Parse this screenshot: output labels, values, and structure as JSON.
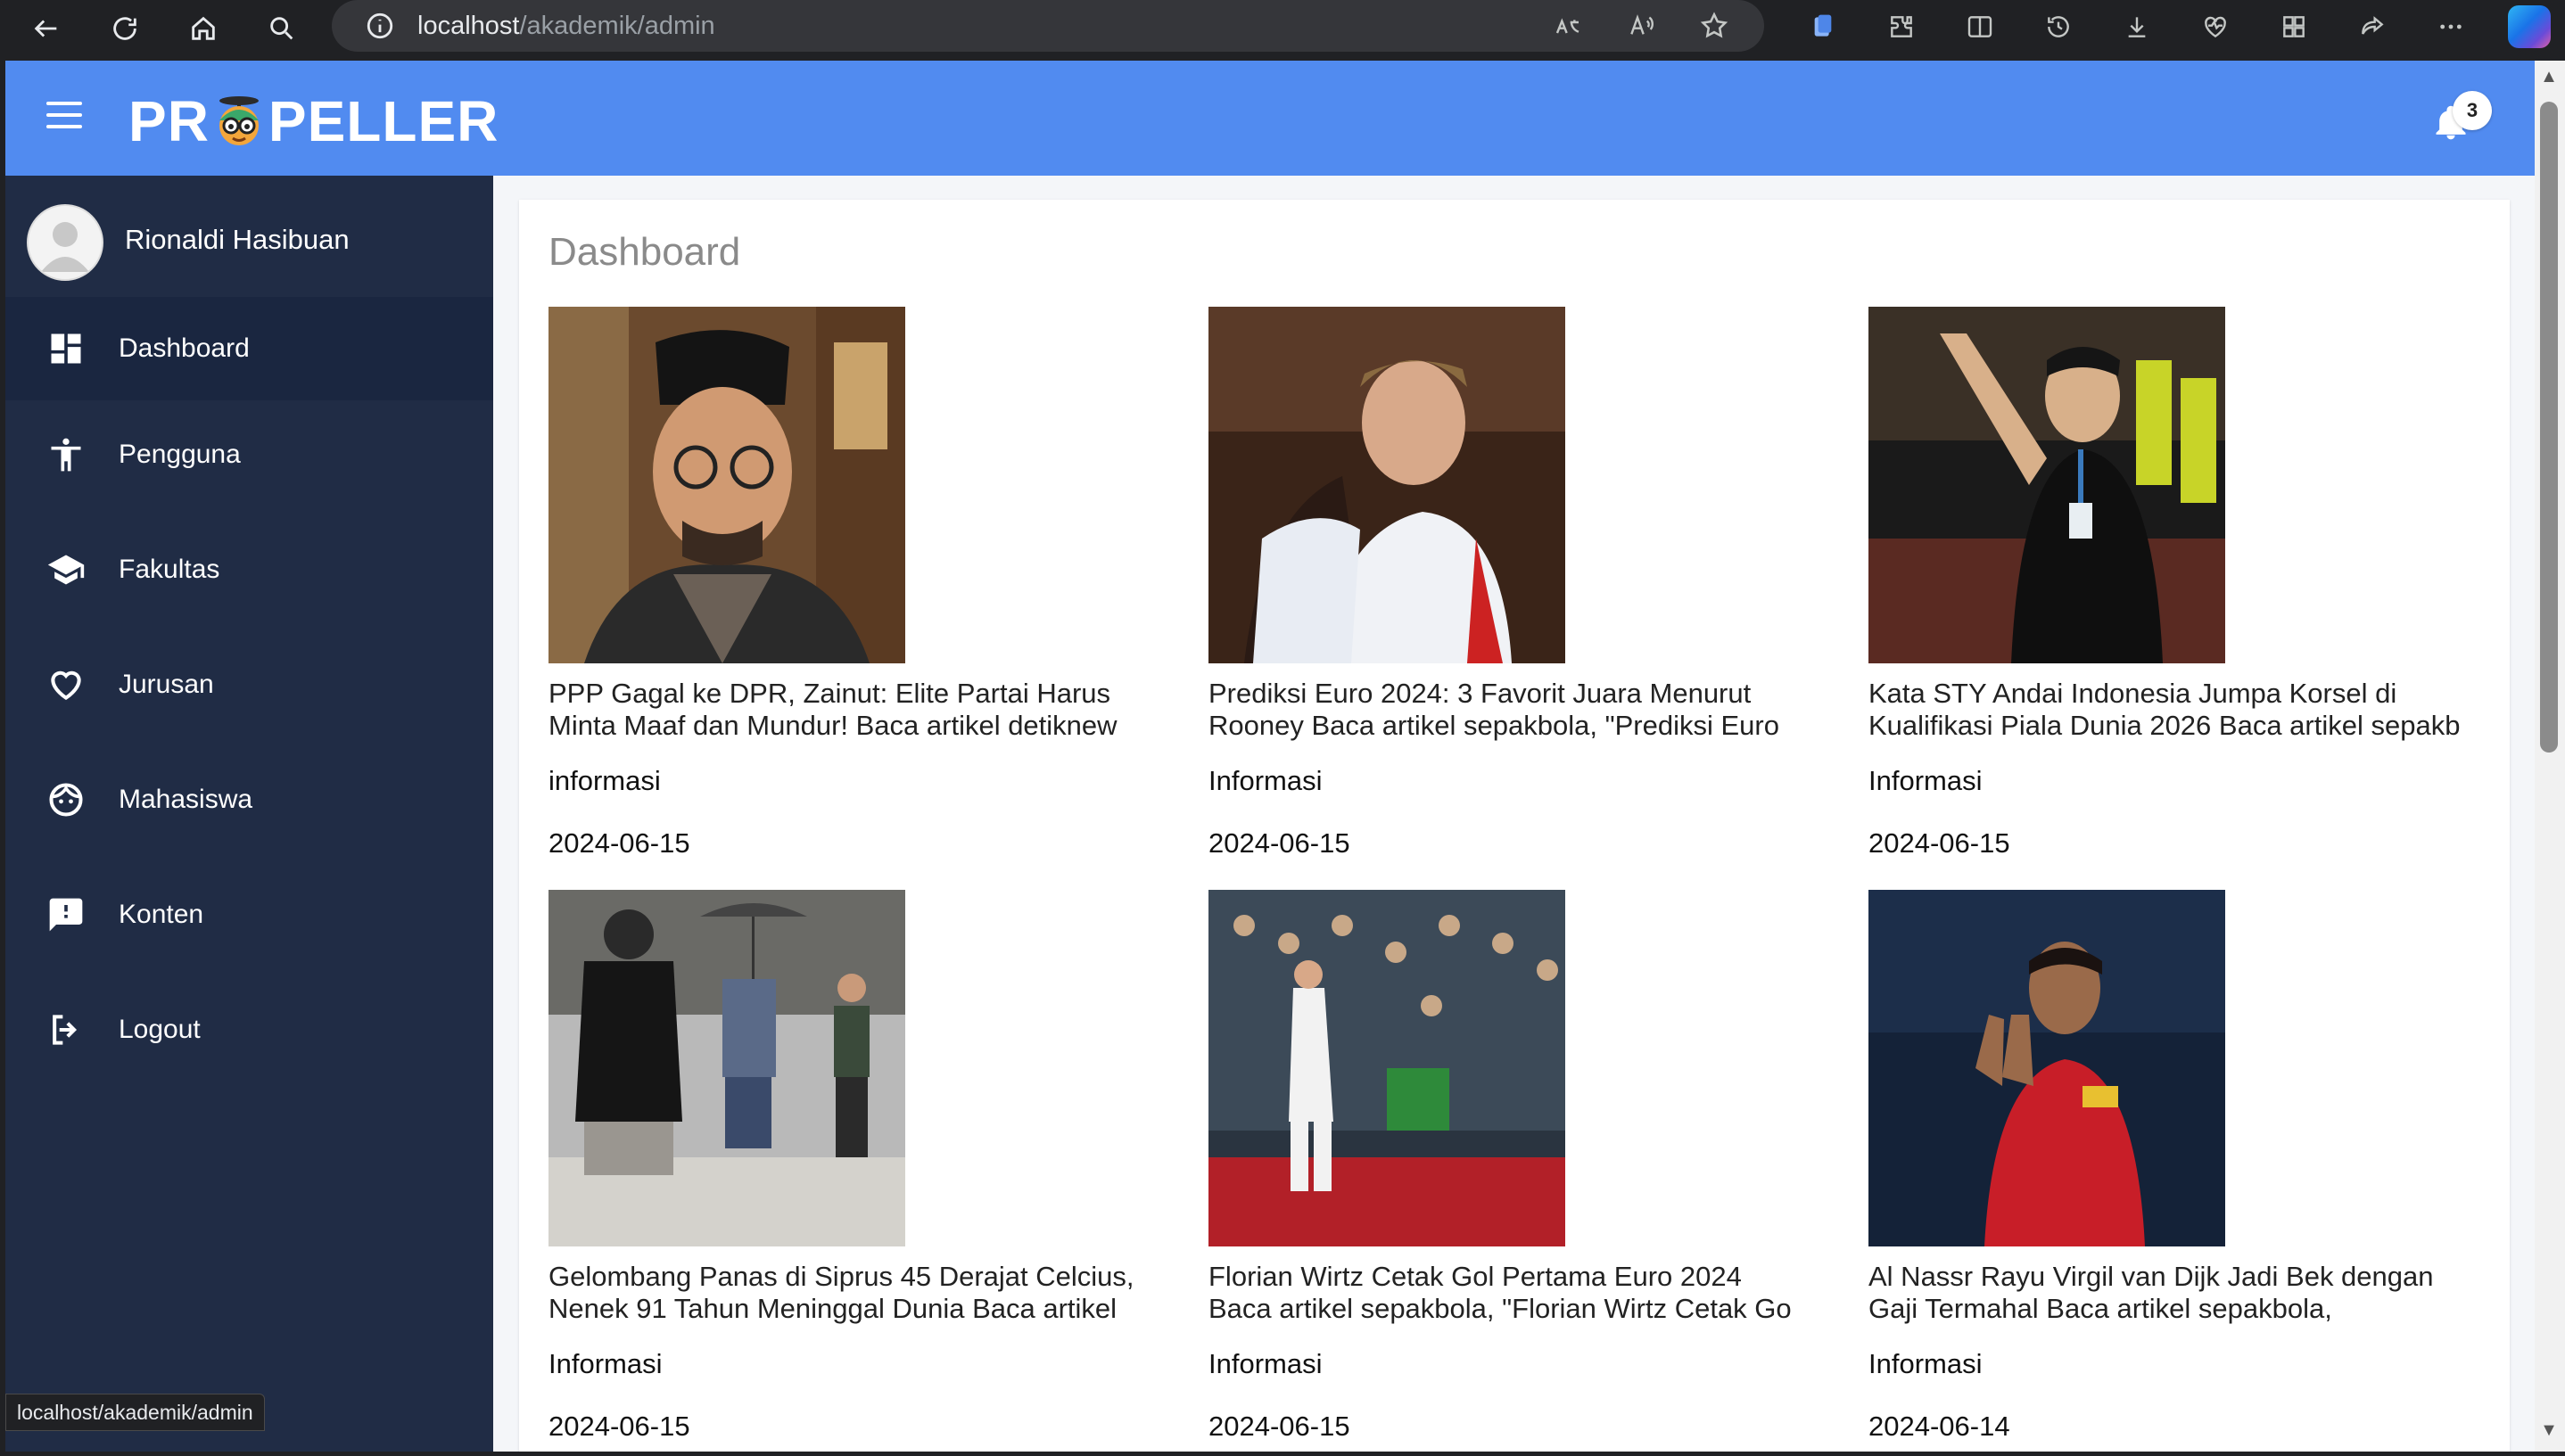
{
  "browser": {
    "url_host": "localhost",
    "url_path": "/akademik/admin",
    "status_url": "localhost/akademik/admin"
  },
  "header": {
    "logo_left": "PR",
    "logo_right": "PELLER",
    "notification_count": "3"
  },
  "sidebar": {
    "user_name": "Rionaldi Hasibuan",
    "items": [
      {
        "label": "Dashboard",
        "icon": "dashboard-icon"
      },
      {
        "label": "Pengguna",
        "icon": "accessibility-icon"
      },
      {
        "label": "Fakultas",
        "icon": "school-icon"
      },
      {
        "label": "Jurusan",
        "icon": "heart-icon"
      },
      {
        "label": "Mahasiswa",
        "icon": "face-icon"
      },
      {
        "label": "Konten",
        "icon": "feedback-icon"
      },
      {
        "label": "Logout",
        "icon": "logout-icon"
      }
    ]
  },
  "main": {
    "title": "Dashboard",
    "articles": [
      {
        "title_l1": "PPP Gagal ke DPR, Zainut: Elite Partai Harus",
        "title_l2": "Minta Maaf dan Mundur! Baca artikel detiknew",
        "category": "informasi",
        "date": "2024-06-15"
      },
      {
        "title_l1": "Prediksi Euro 2024: 3 Favorit Juara Menurut",
        "title_l2": "Rooney Baca artikel sepakbola, \"Prediksi Euro",
        "category": "Informasi",
        "date": "2024-06-15"
      },
      {
        "title_l1": "Kata STY Andai Indonesia Jumpa Korsel di",
        "title_l2": "Kualifikasi Piala Dunia 2026 Baca artikel sepakb",
        "category": "Informasi",
        "date": "2024-06-15"
      },
      {
        "title_l1": "Gelombang Panas di Siprus 45 Derajat Celcius,",
        "title_l2": "Nenek 91 Tahun Meninggal Dunia Baca artikel",
        "category": "Informasi",
        "date": "2024-06-15"
      },
      {
        "title_l1": "Florian Wirtz Cetak Gol Pertama Euro 2024",
        "title_l2": "Baca artikel sepakbola, \"Florian Wirtz Cetak Go",
        "category": "Informasi",
        "date": "2024-06-15"
      },
      {
        "title_l1": "Al Nassr Rayu Virgil van Dijk Jadi Bek dengan",
        "title_l2": "Gaji Termahal Baca artikel sepakbola,",
        "category": "Informasi",
        "date": "2024-06-14"
      }
    ]
  }
}
